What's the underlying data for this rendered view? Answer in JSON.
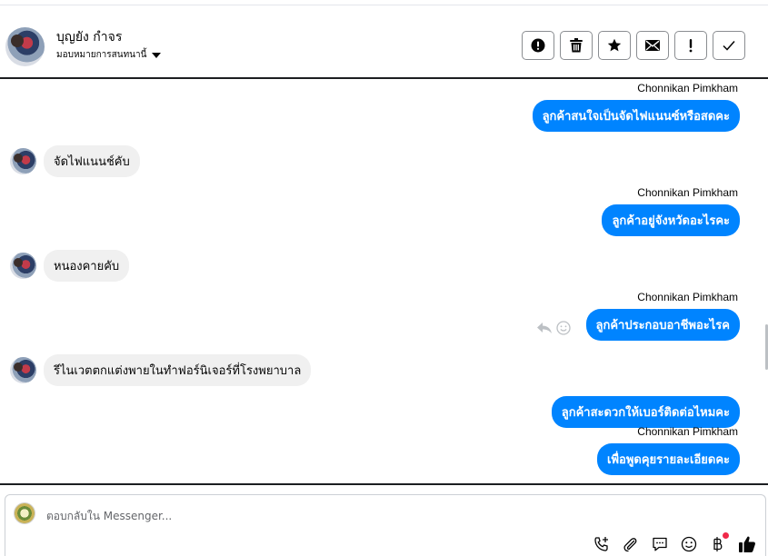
{
  "header": {
    "contact_name": "บุญยัง กำจร",
    "assign_label": "มอบหมายการสนทนานี้"
  },
  "actions": [
    {
      "name": "alert-icon"
    },
    {
      "name": "trash-icon"
    },
    {
      "name": "star-icon"
    },
    {
      "name": "mail-icon"
    },
    {
      "name": "exclamation-icon"
    },
    {
      "name": "check-icon"
    }
  ],
  "messages": [
    {
      "direction": "out",
      "sender": "Chonnikan Pimkham",
      "text": "ลูกค้าสนใจเป็นจัดไฟแนนซ์หรือสดคะ"
    },
    {
      "direction": "in",
      "text": "จัดไฟแนนช์คับ"
    },
    {
      "direction": "out",
      "sender": "Chonnikan Pimkham",
      "text": "ลูกค้าอยู่จังหวัดอะไรคะ"
    },
    {
      "direction": "in",
      "text": "หนองคายคับ"
    },
    {
      "direction": "out",
      "sender": "Chonnikan Pimkham",
      "text": "ลูกค้าประกอบอาชีพอะไรค"
    },
    {
      "direction": "in",
      "text": "รีไนเวตตกแต่งพายในทำฟอร์นิเจอร์ที่โรงพยาบาล"
    },
    {
      "direction": "out",
      "text": "ลูกค้าสะดวกให้เบอร์ติดต่อไหมคะ"
    },
    {
      "direction": "out",
      "sender": "Chonnikan Pimkham",
      "text": "เพื่อพูดคุยรายละเอียดคะ"
    }
  ],
  "composer": {
    "placeholder": "ตอบกลับใน Messenger..."
  },
  "colors": {
    "outgoing_bubble": "#0084ff",
    "incoming_bubble": "#f0f0f0",
    "notification_dot": "#f02849"
  }
}
